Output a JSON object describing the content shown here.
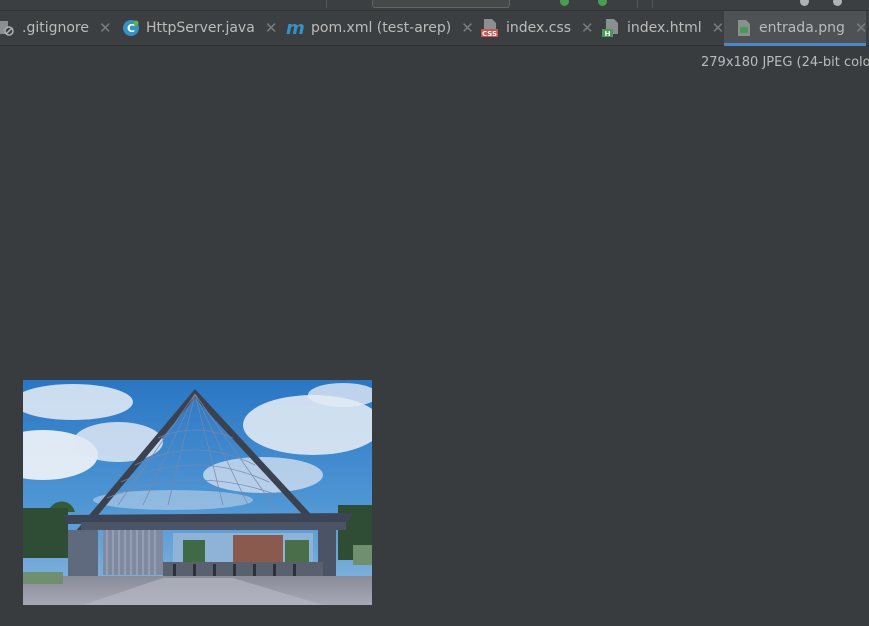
{
  "toolbar": {},
  "tabs": [
    {
      "label": ".gitignore",
      "icon": "gitignore-file-icon"
    },
    {
      "label": "HttpServer.java",
      "icon": "java-class-icon"
    },
    {
      "label": "pom.xml (test-arep)",
      "icon": "maven-icon"
    },
    {
      "label": "index.css",
      "icon": "css-file-icon"
    },
    {
      "label": "index.html",
      "icon": "html-file-icon"
    },
    {
      "label": "entrada.png",
      "icon": "image-file-icon",
      "active": true
    }
  ],
  "image_info": "279x180 JPEG (24-bit colo",
  "preview": {
    "icon": "image-preview",
    "subject": "entrance gate photo"
  },
  "colors": {
    "editor_bg": "#393c3f",
    "tabbar_bg": "#3c3f41",
    "active_tab_bg": "#4e5254",
    "active_underline": "#4a88c7",
    "text": "#bbbbbb"
  }
}
